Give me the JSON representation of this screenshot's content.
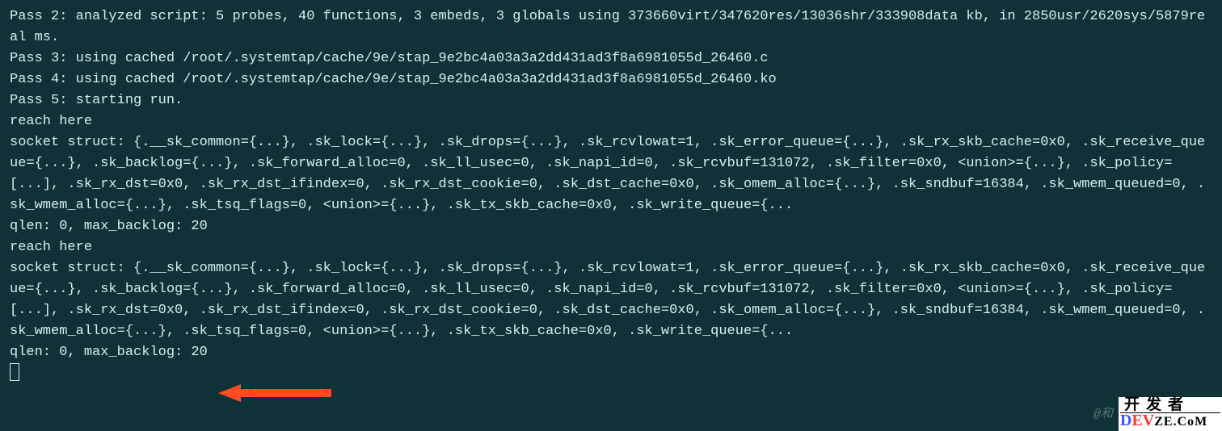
{
  "terminal": {
    "lines": [
      "Pass 2: analyzed script: 5 probes, 40 functions, 3 embeds, 3 globals using 373660virt/347620res/13036shr/333908data kb, in 2850usr/2620sys/5879real ms.",
      "Pass 3: using cached /root/.systemtap/cache/9e/stap_9e2bc4a03a3a2dd431ad3f8a6981055d_26460.c",
      "Pass 4: using cached /root/.systemtap/cache/9e/stap_9e2bc4a03a3a2dd431ad3f8a6981055d_26460.ko",
      "Pass 5: starting run.",
      "reach here",
      "socket struct: {.__sk_common={...}, .sk_lock={...}, .sk_drops={...}, .sk_rcvlowat=1, .sk_error_queue={...}, .sk_rx_skb_cache=0x0, .sk_receive_queue={...}, .sk_backlog={...}, .sk_forward_alloc=0, .sk_ll_usec=0, .sk_napi_id=0, .sk_rcvbuf=131072, .sk_filter=0x0, <union>={...}, .sk_policy=[...], .sk_rx_dst=0x0, .sk_rx_dst_ifindex=0, .sk_rx_dst_cookie=0, .sk_dst_cache=0x0, .sk_omem_alloc={...}, .sk_sndbuf=16384, .sk_wmem_queued=0, .sk_wmem_alloc={...}, .sk_tsq_flags=0, <union>={...}, .sk_tx_skb_cache=0x0, .sk_write_queue={...",
      "qlen: 0, max_backlog: 20",
      "reach here",
      "socket struct: {.__sk_common={...}, .sk_lock={...}, .sk_drops={...}, .sk_rcvlowat=1, .sk_error_queue={...}, .sk_rx_skb_cache=0x0, .sk_receive_queue={...}, .sk_backlog={...}, .sk_forward_alloc=0, .sk_ll_usec=0, .sk_napi_id=0, .sk_rcvbuf=131072, .sk_filter=0x0, <union>={...}, .sk_policy=[...], .sk_rx_dst=0x0, .sk_rx_dst_ifindex=0, .sk_rx_dst_cookie=0, .sk_dst_cache=0x0, .sk_omem_alloc={...}, .sk_sndbuf=16384, .sk_wmem_queued=0, .sk_wmem_alloc={...}, .sk_tsq_flags=0, <union>={...}, .sk_tx_skb_cache=0x0, .sk_write_queue={...",
      "qlen: 0, max_backlog: 20"
    ]
  },
  "annotation": {
    "arrow_color": "#ff4b1f"
  },
  "watermark": {
    "top": "开发者",
    "brand1": "D",
    "brand2": "EV",
    "brand3": "ZE.CoM",
    "attrib": "@和"
  }
}
